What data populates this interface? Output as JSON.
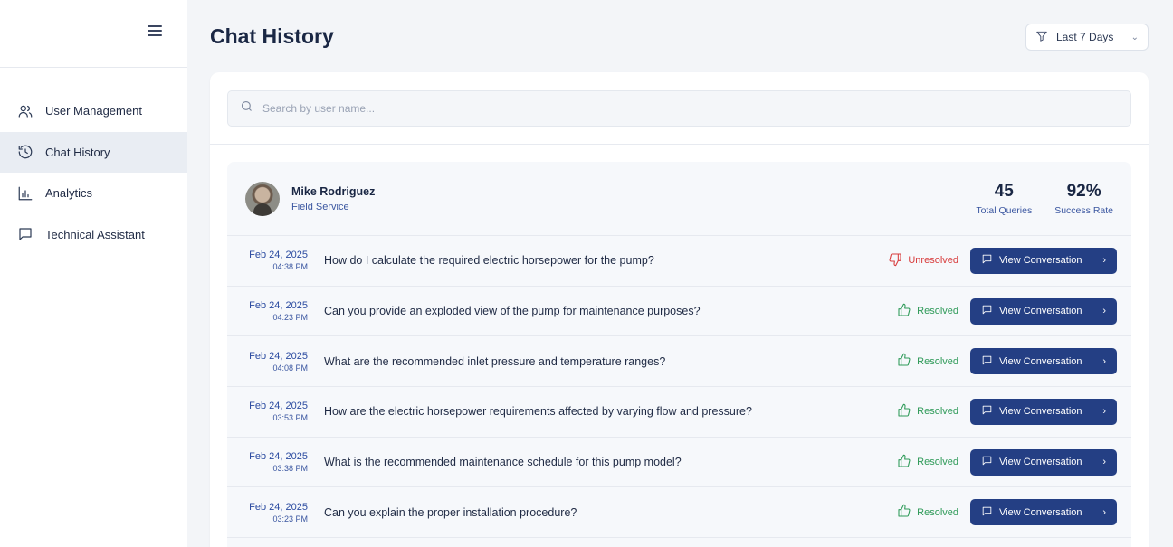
{
  "sidebar": {
    "items": [
      {
        "label": "User Management",
        "icon": "users-icon",
        "active": false
      },
      {
        "label": "Chat History",
        "icon": "history-icon",
        "active": true
      },
      {
        "label": "Analytics",
        "icon": "bar-chart-icon",
        "active": false
      },
      {
        "label": "Technical Assistant",
        "icon": "message-square-icon",
        "active": false
      }
    ]
  },
  "header": {
    "title": "Chat History",
    "filter_label": "Last 7 Days"
  },
  "search": {
    "placeholder": "Search by user name...",
    "value": ""
  },
  "user": {
    "name": "Mike Rodriguez",
    "role": "Field Service",
    "stats": [
      {
        "value": "45",
        "label": "Total Queries"
      },
      {
        "value": "92%",
        "label": "Success Rate"
      }
    ]
  },
  "view_button_label": "View Conversation",
  "conversations": [
    {
      "date": "Feb 24, 2025",
      "time": "04:38 PM",
      "question": "How do I calculate the required electric horsepower for the pump?",
      "status": "Unresolved"
    },
    {
      "date": "Feb 24, 2025",
      "time": "04:23 PM",
      "question": "Can you provide an exploded view of the pump for maintenance purposes?",
      "status": "Resolved"
    },
    {
      "date": "Feb 24, 2025",
      "time": "04:08 PM",
      "question": "What are the recommended inlet pressure and temperature ranges?",
      "status": "Resolved"
    },
    {
      "date": "Feb 24, 2025",
      "time": "03:53 PM",
      "question": "How are the electric horsepower requirements affected by varying flow and pressure?",
      "status": "Resolved"
    },
    {
      "date": "Feb 24, 2025",
      "time": "03:38 PM",
      "question": "What is the recommended maintenance schedule for this pump model?",
      "status": "Resolved"
    },
    {
      "date": "Feb 24, 2025",
      "time": "03:23 PM",
      "question": "Can you explain the proper installation procedure?",
      "status": "Resolved"
    }
  ],
  "colors": {
    "accent": "#243f84",
    "resolved": "#2e9a58",
    "unresolved": "#d83c3c",
    "sidebar_active": "#e9edf3"
  }
}
